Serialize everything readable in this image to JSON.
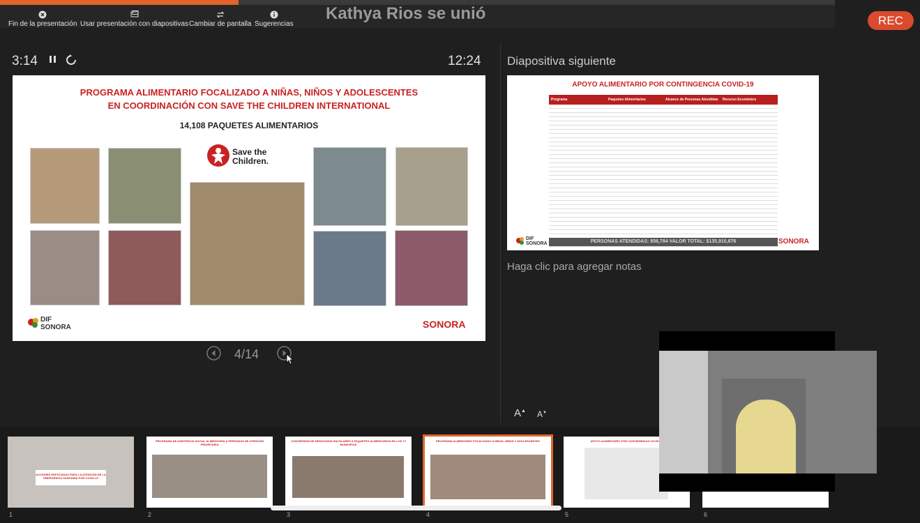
{
  "toolbar": {
    "items": [
      {
        "label": "Fin de la presentación",
        "icon": "close-circle-icon"
      },
      {
        "label": "Usar presentación con diapositivas",
        "icon": "display-icon"
      },
      {
        "label": "Cambiar de pantalla",
        "icon": "swap-icon"
      },
      {
        "label": "Sugerencias",
        "icon": "info-icon"
      }
    ],
    "progress_fraction": 0.286
  },
  "notification": "Kathya Rios se unió",
  "rec_label": "REC",
  "presenter": {
    "elapsed": "3:14",
    "clock": "12:24",
    "counter": "4/14",
    "next_label": "Diapositiva siguiente",
    "notes_placeholder": "Haga clic para agregar notas",
    "font_increase": "A",
    "font_decrease": "A"
  },
  "current_slide": {
    "title_line1": "PROGRAMA ALIMENTARIO FOCALIZADO A NIÑAS, NIÑOS Y ADOLESCENTES",
    "title_line2": "EN COORDINACIÓN CON SAVE THE CHILDREN INTERNATIONAL",
    "subtitle": "14,108 PAQUETES ALIMENTARIOS",
    "partner_logo_text": "Save the Children.",
    "logo_left": "DIF SONORA",
    "logo_right": "SONORA"
  },
  "next_slide": {
    "title": "APOYO ALIMENTARIO POR CONTINGENCIA COVID-19",
    "headers": [
      "Programa",
      "Paquetes Alimentarios",
      "Alcance de Personas Atendidas",
      "Recurso Económico"
    ],
    "footer": "PERSONAS ATENDIDAS: 856,784    VALOR TOTAL: $135,910,876",
    "logo_left": "DIF SONORA",
    "logo_right": "SONORA"
  },
  "thumbnails": [
    {
      "num": "1",
      "title": "ACCIONES ENFOCADAS PARA LA ATENCIÓN DE LA EMERGENCIA SANITARIA POR COVID-19"
    },
    {
      "num": "2",
      "title": "PROGRAMA DE ASISTENCIA SOCIAL ALIMENTARIA A PERSONAS DE ATENCIÓN PRIORITARIA"
    },
    {
      "num": "3",
      "title": "CONVERSIÓN DE DESAYUNOS ESCOLARES A PAQUETES ALIMENTARIOS EN LOS 72 MUNICIPIOS"
    },
    {
      "num": "4",
      "title": "PROGRAMA ALIMENTARIO FOCALIZADO A NIÑAS, NIÑOS Y ADOLESCENTES"
    },
    {
      "num": "5",
      "title": "APOYO ALIMENTARIO POR CONTINGENCIA COVID-19"
    },
    {
      "num": "6",
      "title": ""
    }
  ],
  "colors": {
    "accent": "#e0642c",
    "rec": "#d94a2e",
    "slide_red": "#c92222"
  }
}
